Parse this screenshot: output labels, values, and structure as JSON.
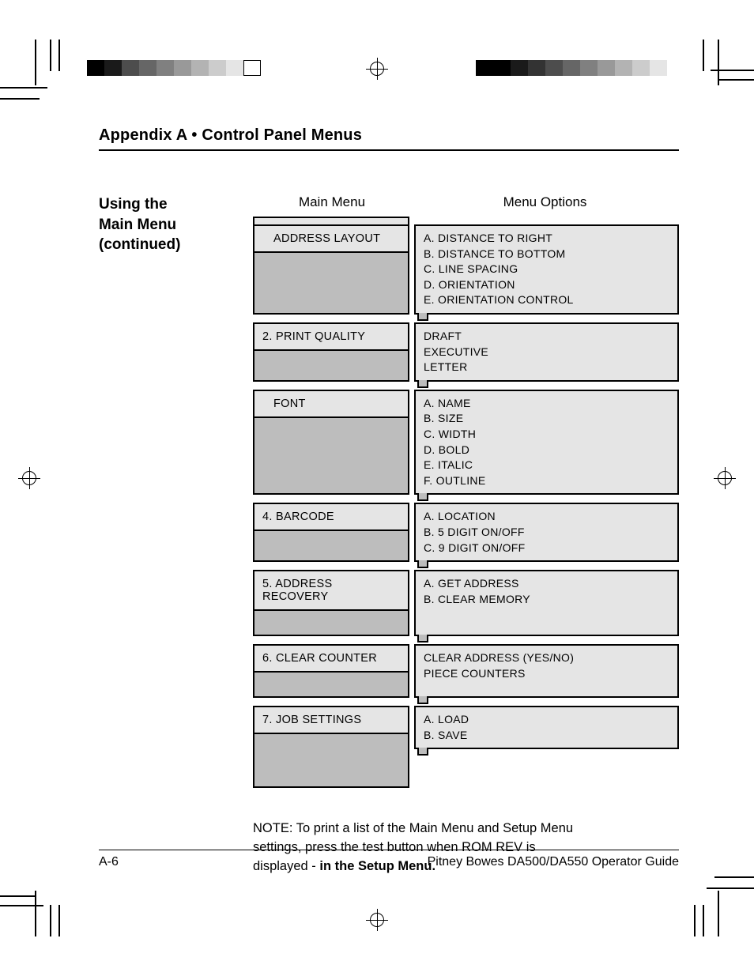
{
  "header": {
    "section": "Appendix A  •   Control Panel Menus"
  },
  "sidetitle": {
    "line1": "Using the",
    "line2": "Main Menu",
    "line3": "(continued)"
  },
  "column_headers": {
    "main": "Main Menu",
    "options": "Menu Options"
  },
  "menu": [
    {
      "label": "ADDRESS LAYOUT",
      "options": [
        "A.  DISTANCE TO RIGHT",
        "B.  DISTANCE TO BOTTOM",
        "C.  LINE SPACING",
        "D.  ORIENTATION",
        "E.  ORIENTATION CONTROL"
      ]
    },
    {
      "label": "2.  PRINT QUALITY",
      "options": [
        "DRAFT",
        "EXECUTIVE",
        "LETTER"
      ]
    },
    {
      "label": "FONT",
      "options": [
        "A.  NAME",
        "B.  SIZE",
        "C.  WIDTH",
        "D.  BOLD",
        "E.  ITALIC",
        "F.  OUTLINE"
      ]
    },
    {
      "label": "4.  BARCODE",
      "options": [
        "A.  LOCATION",
        "B.  5 DIGIT ON/OFF",
        "C.  9 DIGIT ON/OFF"
      ]
    },
    {
      "label": "5.  ADDRESS RECOVERY",
      "options": [
        "A.  GET ADDRESS",
        "B.  CLEAR MEMORY"
      ]
    },
    {
      "label": "6.  CLEAR COUNTER",
      "options": [
        "CLEAR ADDRESS (YES/NO)",
        "PIECE COUNTERS"
      ]
    },
    {
      "label": "7.  JOB SETTINGS",
      "options": [
        "A.  LOAD",
        "B.  SAVE"
      ],
      "extra_shade": true
    }
  ],
  "note": {
    "text": "NOTE: To print a list of the Main Menu and Setup Menu settings, press the test button when ROM REV is displayed - ",
    "bold": "in the Setup Menu."
  },
  "footer": {
    "page": "A-6",
    "title": "Pitney Bowes DA500/DA550 Operator Guide"
  }
}
